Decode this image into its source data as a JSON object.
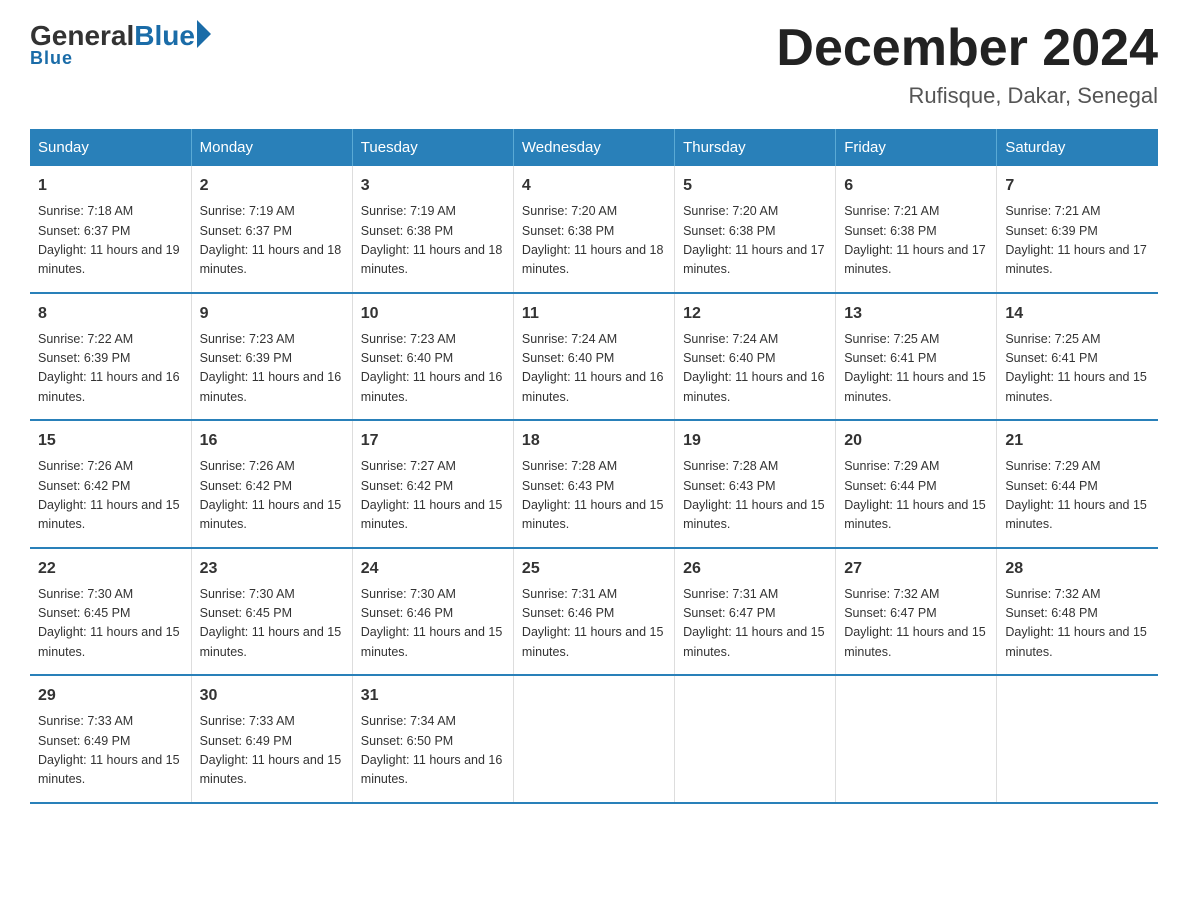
{
  "header": {
    "logo_general": "General",
    "logo_blue": "Blue",
    "month_title": "December 2024",
    "location": "Rufisque, Dakar, Senegal"
  },
  "days_of_week": [
    "Sunday",
    "Monday",
    "Tuesday",
    "Wednesday",
    "Thursday",
    "Friday",
    "Saturday"
  ],
  "weeks": [
    [
      {
        "day": "1",
        "sunrise": "7:18 AM",
        "sunset": "6:37 PM",
        "daylight": "11 hours and 19 minutes."
      },
      {
        "day": "2",
        "sunrise": "7:19 AM",
        "sunset": "6:37 PM",
        "daylight": "11 hours and 18 minutes."
      },
      {
        "day": "3",
        "sunrise": "7:19 AM",
        "sunset": "6:38 PM",
        "daylight": "11 hours and 18 minutes."
      },
      {
        "day": "4",
        "sunrise": "7:20 AM",
        "sunset": "6:38 PM",
        "daylight": "11 hours and 18 minutes."
      },
      {
        "day": "5",
        "sunrise": "7:20 AM",
        "sunset": "6:38 PM",
        "daylight": "11 hours and 17 minutes."
      },
      {
        "day": "6",
        "sunrise": "7:21 AM",
        "sunset": "6:38 PM",
        "daylight": "11 hours and 17 minutes."
      },
      {
        "day": "7",
        "sunrise": "7:21 AM",
        "sunset": "6:39 PM",
        "daylight": "11 hours and 17 minutes."
      }
    ],
    [
      {
        "day": "8",
        "sunrise": "7:22 AM",
        "sunset": "6:39 PM",
        "daylight": "11 hours and 16 minutes."
      },
      {
        "day": "9",
        "sunrise": "7:23 AM",
        "sunset": "6:39 PM",
        "daylight": "11 hours and 16 minutes."
      },
      {
        "day": "10",
        "sunrise": "7:23 AM",
        "sunset": "6:40 PM",
        "daylight": "11 hours and 16 minutes."
      },
      {
        "day": "11",
        "sunrise": "7:24 AM",
        "sunset": "6:40 PM",
        "daylight": "11 hours and 16 minutes."
      },
      {
        "day": "12",
        "sunrise": "7:24 AM",
        "sunset": "6:40 PM",
        "daylight": "11 hours and 16 minutes."
      },
      {
        "day": "13",
        "sunrise": "7:25 AM",
        "sunset": "6:41 PM",
        "daylight": "11 hours and 15 minutes."
      },
      {
        "day": "14",
        "sunrise": "7:25 AM",
        "sunset": "6:41 PM",
        "daylight": "11 hours and 15 minutes."
      }
    ],
    [
      {
        "day": "15",
        "sunrise": "7:26 AM",
        "sunset": "6:42 PM",
        "daylight": "11 hours and 15 minutes."
      },
      {
        "day": "16",
        "sunrise": "7:26 AM",
        "sunset": "6:42 PM",
        "daylight": "11 hours and 15 minutes."
      },
      {
        "day": "17",
        "sunrise": "7:27 AM",
        "sunset": "6:42 PM",
        "daylight": "11 hours and 15 minutes."
      },
      {
        "day": "18",
        "sunrise": "7:28 AM",
        "sunset": "6:43 PM",
        "daylight": "11 hours and 15 minutes."
      },
      {
        "day": "19",
        "sunrise": "7:28 AM",
        "sunset": "6:43 PM",
        "daylight": "11 hours and 15 minutes."
      },
      {
        "day": "20",
        "sunrise": "7:29 AM",
        "sunset": "6:44 PM",
        "daylight": "11 hours and 15 minutes."
      },
      {
        "day": "21",
        "sunrise": "7:29 AM",
        "sunset": "6:44 PM",
        "daylight": "11 hours and 15 minutes."
      }
    ],
    [
      {
        "day": "22",
        "sunrise": "7:30 AM",
        "sunset": "6:45 PM",
        "daylight": "11 hours and 15 minutes."
      },
      {
        "day": "23",
        "sunrise": "7:30 AM",
        "sunset": "6:45 PM",
        "daylight": "11 hours and 15 minutes."
      },
      {
        "day": "24",
        "sunrise": "7:30 AM",
        "sunset": "6:46 PM",
        "daylight": "11 hours and 15 minutes."
      },
      {
        "day": "25",
        "sunrise": "7:31 AM",
        "sunset": "6:46 PM",
        "daylight": "11 hours and 15 minutes."
      },
      {
        "day": "26",
        "sunrise": "7:31 AM",
        "sunset": "6:47 PM",
        "daylight": "11 hours and 15 minutes."
      },
      {
        "day": "27",
        "sunrise": "7:32 AM",
        "sunset": "6:47 PM",
        "daylight": "11 hours and 15 minutes."
      },
      {
        "day": "28",
        "sunrise": "7:32 AM",
        "sunset": "6:48 PM",
        "daylight": "11 hours and 15 minutes."
      }
    ],
    [
      {
        "day": "29",
        "sunrise": "7:33 AM",
        "sunset": "6:49 PM",
        "daylight": "11 hours and 15 minutes."
      },
      {
        "day": "30",
        "sunrise": "7:33 AM",
        "sunset": "6:49 PM",
        "daylight": "11 hours and 15 minutes."
      },
      {
        "day": "31",
        "sunrise": "7:34 AM",
        "sunset": "6:50 PM",
        "daylight": "11 hours and 16 minutes."
      },
      null,
      null,
      null,
      null
    ]
  ]
}
